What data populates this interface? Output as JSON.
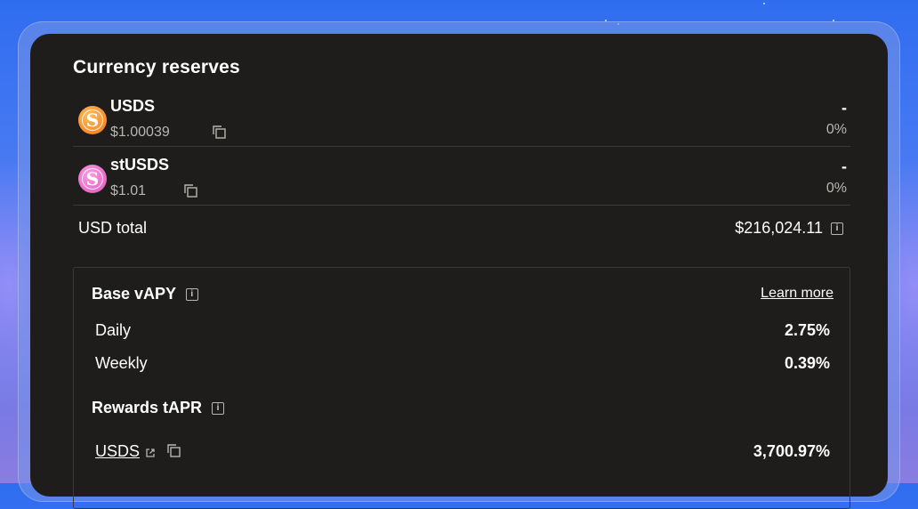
{
  "reserves": {
    "title": "Currency reserves",
    "items": [
      {
        "name": "USDS",
        "price": "$1.00039",
        "amount": "-",
        "percent": "0%",
        "icon": "usds-coin-icon"
      },
      {
        "name": "stUSDS",
        "price": "$1.01",
        "amount": "-",
        "percent": "0%",
        "icon": "stusds-coin-icon"
      }
    ],
    "total_label": "USD total",
    "total_value": "$216,024.11"
  },
  "apy": {
    "title": "Base vAPY",
    "learn_more": "Learn more",
    "rows": [
      {
        "label": "Daily",
        "value": "2.75%"
      },
      {
        "label": "Weekly",
        "value": "0.39%"
      }
    ]
  },
  "rewards": {
    "title": "Rewards tAPR",
    "token": "USDS",
    "value": "3,700.97%"
  },
  "colors": {
    "card_bg": "#1e1d1c",
    "usds": "#f58a2a",
    "stusds": "#e56ac6",
    "muted_text": "#b8b6b2"
  }
}
